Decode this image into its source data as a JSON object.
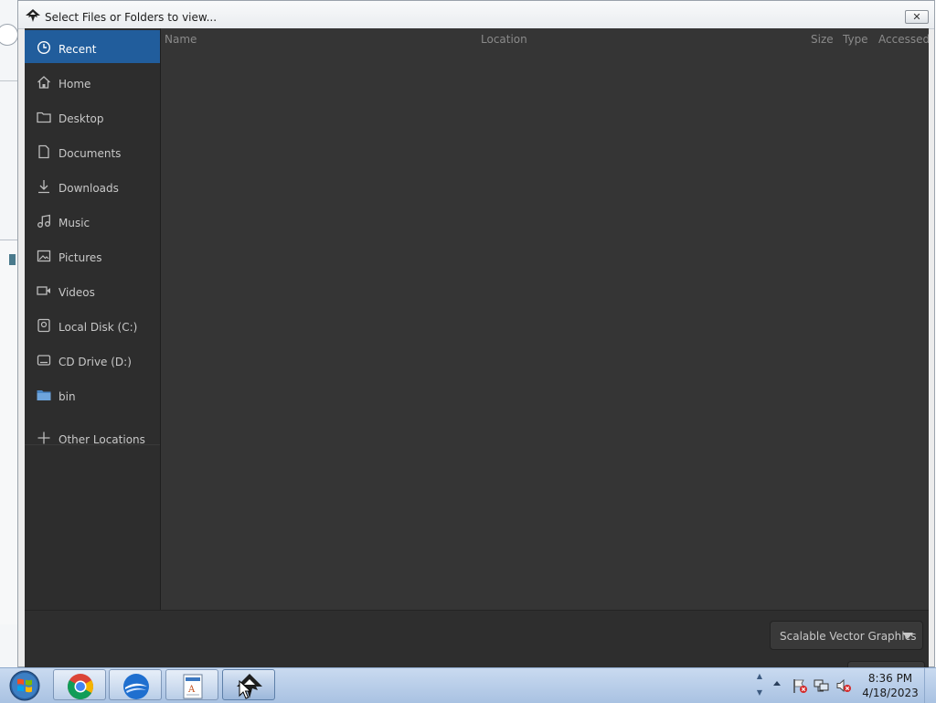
{
  "window": {
    "title": "Select Files or Folders to view...",
    "close_glyph": "✕"
  },
  "sidebar": {
    "items": [
      {
        "label": "Recent",
        "icon": "clock-icon",
        "active": true
      },
      {
        "label": "Home",
        "icon": "home-icon"
      },
      {
        "label": "Desktop",
        "icon": "folder-icon"
      },
      {
        "label": "Documents",
        "icon": "document-icon"
      },
      {
        "label": "Downloads",
        "icon": "download-icon"
      },
      {
        "label": "Music",
        "icon": "music-icon"
      },
      {
        "label": "Pictures",
        "icon": "picture-icon"
      },
      {
        "label": "Videos",
        "icon": "video-icon"
      },
      {
        "label": "Local Disk (C:)",
        "icon": "disk-icon"
      },
      {
        "label": "CD Drive (D:)",
        "icon": "cd-drive-icon"
      },
      {
        "label": "bin",
        "icon": "blue-folder-icon"
      },
      {
        "label": "Other Locations",
        "icon": "plus-icon"
      }
    ]
  },
  "filelist": {
    "columns": [
      "Name",
      "Location",
      "Size",
      "Type",
      "Accessed"
    ]
  },
  "footer": {
    "filter": "Scalable Vector Graphics"
  },
  "taskbar": {
    "apps": [
      {
        "name": "chrome",
        "icon": "chrome-icon"
      },
      {
        "name": "thunderbird",
        "icon": "thunderbird-icon"
      },
      {
        "name": "document-viewer",
        "icon": "document-viewer-icon"
      },
      {
        "name": "inkscape",
        "icon": "inkscape-icon",
        "active": true
      }
    ],
    "clock": {
      "time": "8:36 PM",
      "date": "4/18/2023"
    }
  },
  "colors": {
    "accent": "#215d9c",
    "sidebar_bg": "#2d2d2d",
    "list_bg": "#353535"
  }
}
